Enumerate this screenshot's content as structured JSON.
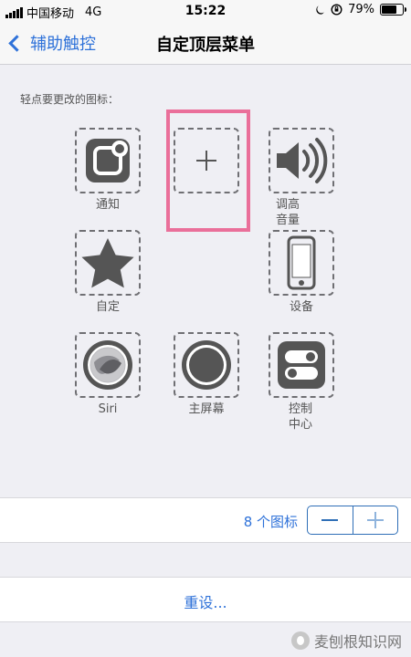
{
  "status_bar": {
    "carrier": "中国移动",
    "network": "4G",
    "time": "15:22",
    "battery_percent": "79%",
    "battery_level": 0.79
  },
  "nav": {
    "back_label": "辅助触控",
    "title": "自定顶层菜单"
  },
  "section_hint": "轻点要更改的图标：",
  "tiles": [
    {
      "label": "通知",
      "icon": "notification-icon"
    },
    {
      "label": "",
      "icon": "add-icon"
    },
    {
      "label": "调高\n音量",
      "icon": "volume-up-icon"
    },
    {
      "label": "自定",
      "icon": "star-icon"
    },
    {
      "label": "设备",
      "icon": "device-icon"
    },
    {
      "label": "Siri",
      "icon": "siri-icon"
    },
    {
      "label": "主屏幕",
      "icon": "home-icon"
    },
    {
      "label": "控制\n中心",
      "icon": "control-center-icon"
    }
  ],
  "icon_count": {
    "value": 8,
    "label": "8 个图标"
  },
  "reset_label": "重设...",
  "watermark": "麦刨根知识网",
  "colors": {
    "accent": "#2f72d9",
    "highlight": "#ea6f9a",
    "background": "#efeff4"
  }
}
